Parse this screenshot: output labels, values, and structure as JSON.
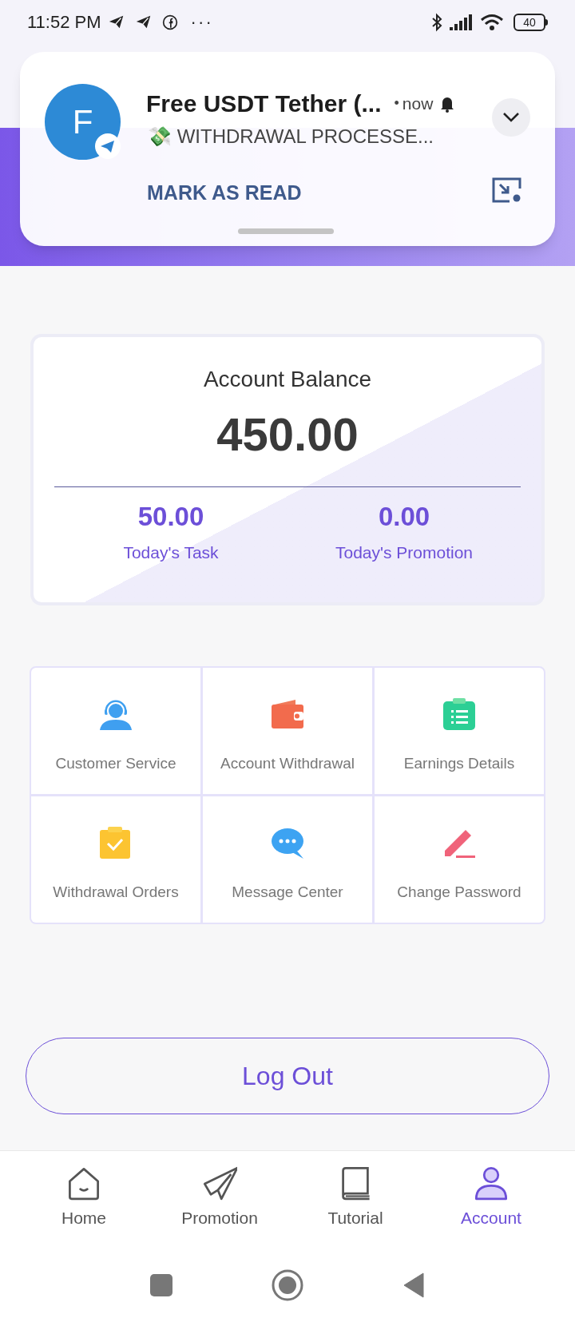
{
  "status_bar": {
    "time": "11:52 PM",
    "more": "···",
    "battery": "40"
  },
  "notification": {
    "avatar_letter": "F",
    "title": "Free USDT Tether (...",
    "separator": "•",
    "time": "now",
    "message": "💸 WITHDRAWAL PROCESSE...",
    "action": "MARK AS READ"
  },
  "balance_card": {
    "title": "Account Balance",
    "amount": "450.00",
    "stats": [
      {
        "value": "50.00",
        "label": "Today's Task"
      },
      {
        "value": "0.00",
        "label": "Today's Promotion"
      }
    ]
  },
  "menu_grid": [
    {
      "label": "Customer Service"
    },
    {
      "label": "Account Withdrawal"
    },
    {
      "label": "Earnings Details"
    },
    {
      "label": "Withdrawal Orders"
    },
    {
      "label": "Message Center"
    },
    {
      "label": "Change Password"
    }
  ],
  "logout_button": "Log Out",
  "bottom_nav": [
    {
      "label": "Home",
      "selected": false
    },
    {
      "label": "Promotion",
      "selected": false
    },
    {
      "label": "Tutorial",
      "selected": false
    },
    {
      "label": "Account",
      "selected": true
    }
  ]
}
